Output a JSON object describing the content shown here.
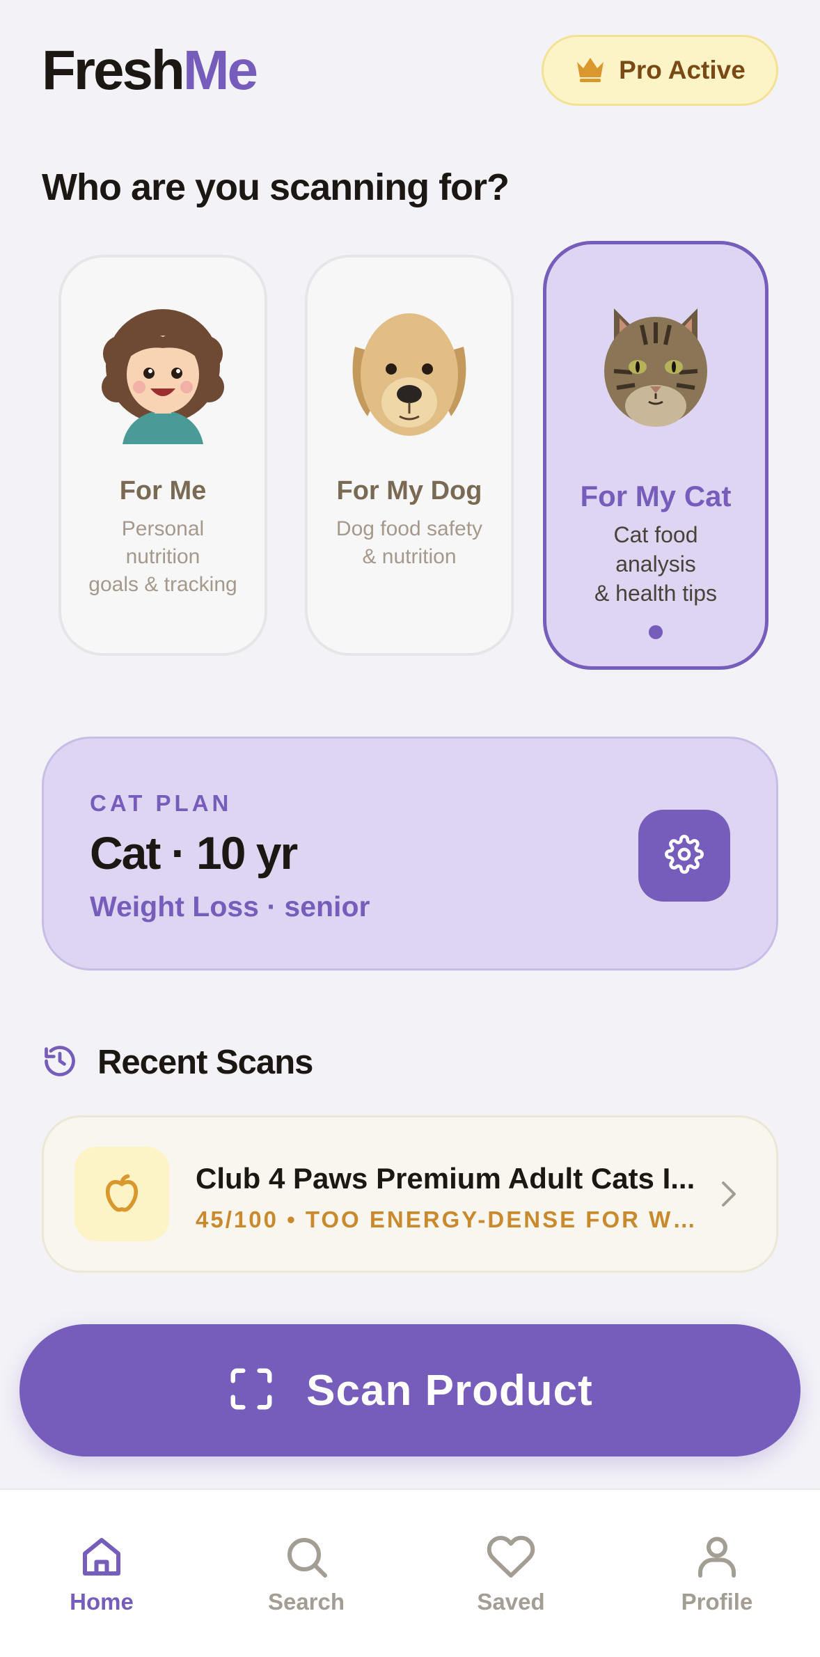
{
  "header": {
    "logo_part1": "Fresh",
    "logo_part2": "Me",
    "badge_label": "Pro Active",
    "badge_icon": "crown-icon"
  },
  "section_title": "Who are you scanning for?",
  "profiles": [
    {
      "title": "For Me",
      "subtitle": "Personal\nnutrition\ngoals & tracking",
      "icon": "girl-avatar-icon",
      "selected": false
    },
    {
      "title": "For My Dog",
      "subtitle": "Dog food safety\n& nutrition",
      "icon": "dog-avatar-icon",
      "selected": false
    },
    {
      "title": "For My Cat",
      "subtitle": "Cat food\nanalysis\n& health tips",
      "icon": "cat-avatar-icon",
      "selected": true
    }
  ],
  "plan": {
    "eyebrow": "CAT PLAN",
    "title": "Cat · 10 yr",
    "subtitle": "Weight Loss · senior",
    "settings_icon": "gear-icon"
  },
  "recent": {
    "title": "Recent Scans",
    "icon": "history-icon",
    "items": [
      {
        "name": "Club 4 Paws Premium Adult Cats I...",
        "meta": "45/100 • TOO ENERGY-DENSE FOR WEI...",
        "icon": "apple-icon"
      }
    ]
  },
  "scan_button": {
    "label": "Scan Product",
    "icon": "scan-frame-icon"
  },
  "nav": [
    {
      "label": "Home",
      "icon": "home-icon",
      "active": true
    },
    {
      "label": "Search",
      "icon": "search-icon",
      "active": false
    },
    {
      "label": "Saved",
      "icon": "heart-icon",
      "active": false
    },
    {
      "label": "Profile",
      "icon": "profile-icon",
      "active": false
    }
  ],
  "colors": {
    "accent": "#775dbb",
    "accent_light": "#ddd5f1",
    "background": "#f3f2f7",
    "badge_bg": "#fcf3c7",
    "warning_text": "#c98a2d"
  }
}
